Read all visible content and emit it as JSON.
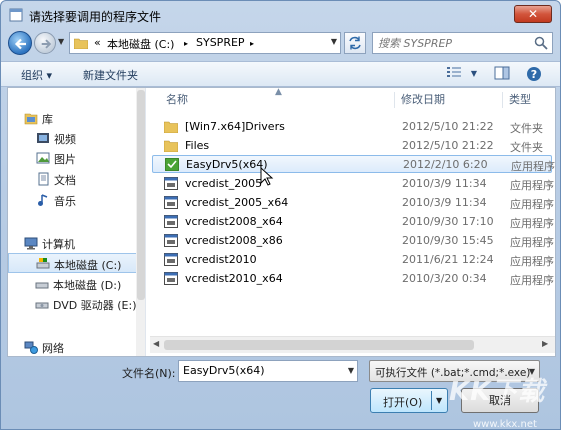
{
  "window": {
    "title": "请选择要调用的程序文件",
    "close_label": "✕"
  },
  "address": {
    "prefix": "«",
    "crumbs": [
      "本地磁盘 (C:)",
      "SYSPREP"
    ],
    "separator": "▸"
  },
  "search": {
    "placeholder": "搜索 SYSPREP"
  },
  "toolbar": {
    "organize_label": "组织 ▾",
    "new_folder_label": "新建文件夹"
  },
  "sidebar": {
    "items": [
      {
        "label": "库",
        "icon": "library-icon"
      },
      {
        "label": "视频",
        "icon": "video-icon"
      },
      {
        "label": "图片",
        "icon": "picture-icon"
      },
      {
        "label": "文档",
        "icon": "document-icon"
      },
      {
        "label": "音乐",
        "icon": "music-icon"
      },
      {
        "label": "计算机",
        "icon": "computer-icon"
      },
      {
        "label": "本地磁盘 (C:)",
        "icon": "drive-icon"
      },
      {
        "label": "本地磁盘 (D:)",
        "icon": "drive-icon"
      },
      {
        "label": "DVD 驱动器 (E:)",
        "icon": "dvd-icon"
      },
      {
        "label": "网络",
        "icon": "network-icon"
      }
    ]
  },
  "columns": {
    "name": "名称",
    "date": "修改日期",
    "type": "类型"
  },
  "files": [
    {
      "name": "[Win7.x64]Drivers",
      "date": "2012/5/10 21:22",
      "type": "文件夹",
      "kind": "folder"
    },
    {
      "name": "Files",
      "date": "2012/5/10 21:22",
      "type": "文件夹",
      "kind": "folder"
    },
    {
      "name": "EasyDrv5(x64)",
      "date": "2012/2/10 6:20",
      "type": "应用程序",
      "kind": "app-green"
    },
    {
      "name": "vcredist_2005",
      "date": "2010/3/9 11:34",
      "type": "应用程序",
      "kind": "app"
    },
    {
      "name": "vcredist_2005_x64",
      "date": "2010/3/9 11:34",
      "type": "应用程序",
      "kind": "app"
    },
    {
      "name": "vcredist2008_x64",
      "date": "2010/9/30 17:10",
      "type": "应用程序",
      "kind": "app"
    },
    {
      "name": "vcredist2008_x86",
      "date": "2010/9/30 15:45",
      "type": "应用程序",
      "kind": "app"
    },
    {
      "name": "vcredist2010",
      "date": "2011/6/21 12:24",
      "type": "应用程序",
      "kind": "app"
    },
    {
      "name": "vcredist2010_x64",
      "date": "2010/3/20 0:34",
      "type": "应用程序",
      "kind": "app"
    }
  ],
  "footer": {
    "filename_label": "文件名(N):",
    "filename_value": "EasyDrv5(x64)",
    "filetype_value": "可执行文件 (*.bat;*.cmd;*.exe)",
    "open_label": "打开(O)",
    "cancel_label": "取消"
  },
  "watermark": {
    "logo": "KK下载",
    "url": "www.kkx.net"
  },
  "colors": {
    "selection": "#dcebfc",
    "accent": "#3c7fb1",
    "close": "#c23a20"
  }
}
